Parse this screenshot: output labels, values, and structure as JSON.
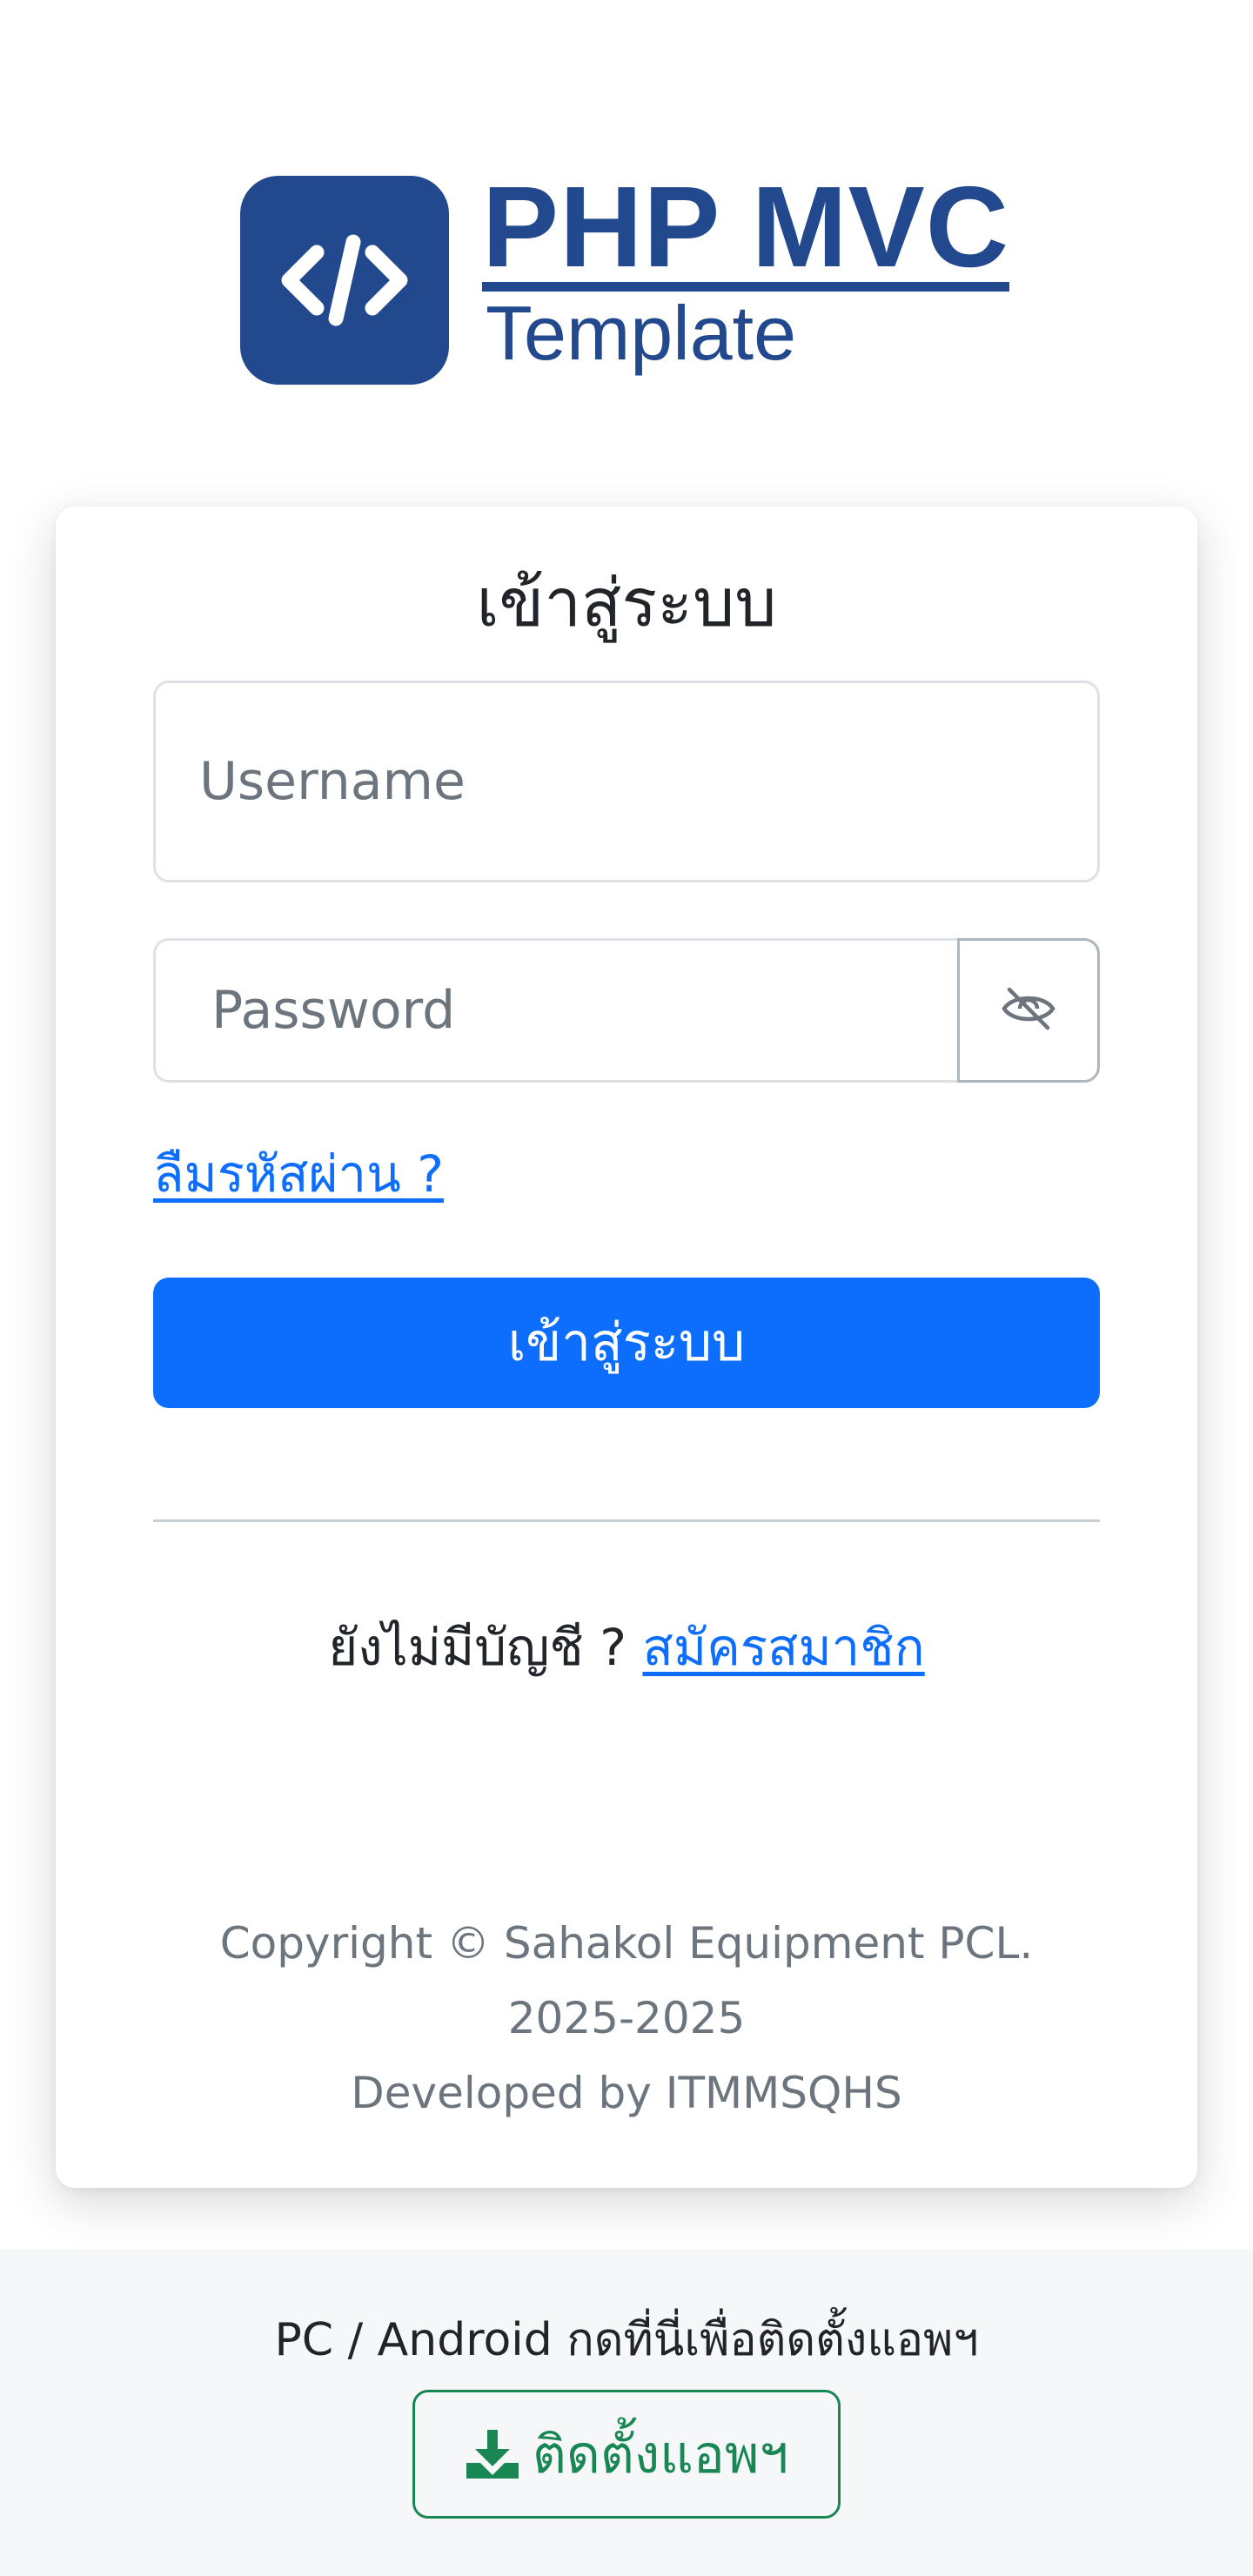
{
  "logo": {
    "title": "PHP MVC",
    "subtitle": "Template",
    "icon": "code-icon",
    "color": "#22488d"
  },
  "login": {
    "title": "เข้าสู่ระบบ",
    "username_placeholder": "Username",
    "password_placeholder": "Password",
    "toggle_icon": "eye-slash-icon",
    "forgot_label": "ลืมรหัสผ่าน ?",
    "submit_label": "เข้าสู่ระบบ",
    "no_account_label": "ยังไม่มีบัญชี ?",
    "register_label": "สมัครสมาชิก",
    "primary_color": "#0d6efd"
  },
  "footer": {
    "copyright": "Copyright © Sahakol Equipment PCL.",
    "years": "2025-2025",
    "developed_by": "Developed by ITMMSQHS"
  },
  "install": {
    "prompt": "PC / Android กดที่นี่เพื่อติดตั้งแอพฯ",
    "button_label": "ติดตั้งแอพฯ",
    "button_icon": "download-icon",
    "color": "#198754"
  }
}
